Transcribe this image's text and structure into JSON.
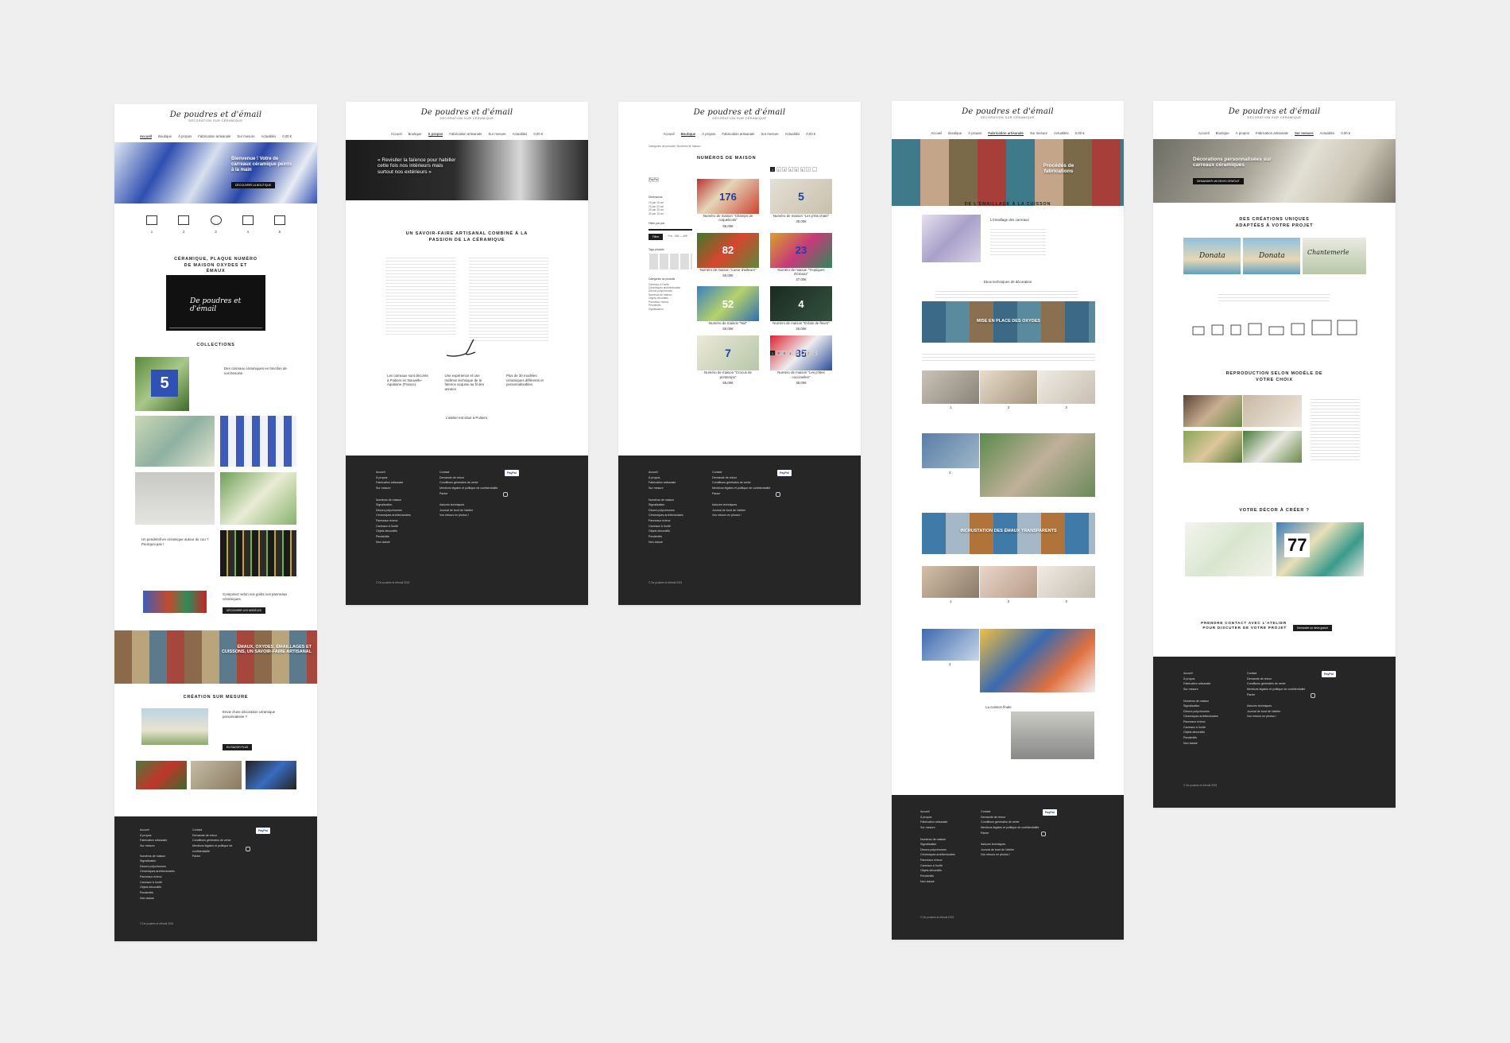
{
  "brand": {
    "logo": "De poudres et d'émail",
    "tagline": "DÉCORATION SUR CÉRAMIQUE"
  },
  "nav": [
    "Accueil",
    "Boutique",
    "À propos",
    "Fabrication artisanale",
    "Sur mesure",
    "Actualités"
  ],
  "nav_extra": {
    "cart": "0,00 €"
  },
  "footer": {
    "col1": [
      "Accueil",
      "À propos",
      "Fabrication artisanale",
      "Sur mesure"
    ],
    "col1b": [
      "Numéros de maison",
      "Signalisation",
      "Décors polychromes",
      "Céramiques architecturales",
      "Panneaux rivieux",
      "Carreaux à l'unité",
      "Objets décoratifs",
      "Pendentifs",
      "Non classé"
    ],
    "col2": [
      "Contact",
      "Demande de retour",
      "Conditions générales de vente",
      "Mentions légales et politique de confidentialité",
      "Panier"
    ],
    "col2b": [
      "Astuces techniques",
      "Journal de bord de l'atelier",
      "Vos retours en photos !"
    ],
    "pay_label": "PayPal",
    "copyright": "© De poudres et d'émail 2023"
  },
  "page1": {
    "hero_text": "Bienvenue ! Votre de carreaux céramique peints à la main",
    "hero_button": "DÉCOUVRIR LA BOUTIQUE",
    "steps": [
      "1",
      "2",
      "3",
      "4",
      "5"
    ],
    "section_video": "CÉRAMIQUE, PLAQUE NUMÉRO DE MAISON OXYDES ET ÉMAUX",
    "section_collections": "COLLECTIONS",
    "collection_text_1": "Des carreaux céramiques en fonction de vos besoins",
    "collection_text_2": "Un pendentif en céramique autour du cou ? Pourquoi pas !",
    "collection_text_3": "Composez selon vos goûts vos panneaux céramiques",
    "collection_btn": "DÉCOUVRIR LES MODÈLES",
    "band_text": "ÉMAUX, OXYDES, ÉMAILLAGES ET CUISSONS, UN SAVOIR-FAIRE ARTISANAL",
    "section_custom": "CRÉATION SUR MESURE",
    "custom_text": "Envie d'une décoration céramique personnalisée ?",
    "custom_btn": "EN SAVOIR PLUS"
  },
  "page2": {
    "hero_text": "« Revisiter la faïence pour habiller cette fois nos intérieurs mais surtout nos extérieurs »",
    "section_title": "UN SAVOIR-FAIRE ARTISANAL COMBINÉ À LA PASSION DE LA CÉRAMIQUE",
    "features": [
      "Les carreaux sont décorés à Poitiers en Nouvelle-Aquitaine (France).",
      "Une expérience et une maîtrise technique de la faïence acquise au fil des années",
      "Plus de 30 modèles céramiques différents et personnalisables."
    ],
    "closing": "L'atelier est situé à Poitiers."
  },
  "page3": {
    "breadcrumb": "Catégories de produits / Numéros de maison",
    "title": "NUMÉROS DE MAISON",
    "filters": {
      "dimensions": "Dimensions",
      "price": "Filtrer par prix",
      "filter_btn": "Filtrer",
      "price_range": "Prix : 36€ — 60€",
      "tags": "Tags produits",
      "categories": "Catégories de produits"
    },
    "dim_options": [
      "15 par 15 cm",
      "20 par 20 cm",
      "25 par 15 cm",
      "30 par 15 cm"
    ],
    "categories": [
      "Carreaux à l'unité",
      "Céramiques architecturales",
      "Décors polychromes",
      "Numéros de maison",
      "Objets décoratifs",
      "Panneaux rivieux",
      "Pendentifs",
      "Signalisation"
    ],
    "pages": [
      "1",
      "2",
      "3",
      "4",
      "5",
      "6",
      "7",
      "8",
      "→"
    ],
    "products": [
      {
        "name": "Numéro de maison \"Champs de coquelicots\"",
        "price": "55,00€",
        "num": "176"
      },
      {
        "name": "Numéro de maison \"Les p'tits chats\"",
        "price": "38,00€",
        "num": "5"
      },
      {
        "name": "Numéro de maison \"Lueur d'ailleurs\"",
        "price": "50,00€",
        "num": "82"
      },
      {
        "name": "Numéro de maison \"Tropiques d'émaux\"",
        "price": "47,00€",
        "num": "23"
      },
      {
        "name": "Numéro de maison \"Nid\"",
        "price": "50,00€",
        "num": "52"
      },
      {
        "name": "Numéro de maison \"Éclats de fleurs\"",
        "price": "36,00€",
        "num": "4"
      },
      {
        "name": "Numéro de maison \"Crocus de printemps\"",
        "price": "55,00€",
        "num": "7"
      },
      {
        "name": "Numéro de maison \"Les p'tites coccinelles\"",
        "price": "38,00€",
        "num": "35"
      }
    ]
  },
  "page4": {
    "hero_text": "Procédés de fabrications",
    "title": "DE L'ÉMAILLAGE À LA CUISSON",
    "sub1": "L'émaillage des carreaux",
    "sub2": "Deux techniques de décoration",
    "band1": "MISE EN PLACE DES OXYDES",
    "band2": "INCRUSTATION DES ÉMAUX TRANSPARENTS",
    "final": "La cuisson finale",
    "steps": [
      "1",
      "2",
      "3",
      "4"
    ]
  },
  "page5": {
    "hero_text": "Décorations personnalisées sur carreaux céramiques",
    "hero_button": "DEMANDER UN DEVIS GRATUIT",
    "title1": "DES CRÉATIONS UNIQUES ADAPTÉES À VOTRE PROJET",
    "title2": "REPRODUCTION SELON MODÈLE DE VOTRE CHOIX",
    "title3": "VOTRE DÉCOR À CRÉER ?",
    "cta": "PRENDRE CONTACT AVEC L'ATELIER POUR DISCUTER DE VOTRE PROJET",
    "cta_btn": "Demander un devis gratuit",
    "names": [
      "Donata",
      "Donata",
      "Chantemerle"
    ],
    "num77": "77"
  },
  "colors": {
    "bg": "#efefef",
    "footer": "#262626",
    "accent": "#1d1d1d",
    "paypal": "#1a3d8f"
  }
}
